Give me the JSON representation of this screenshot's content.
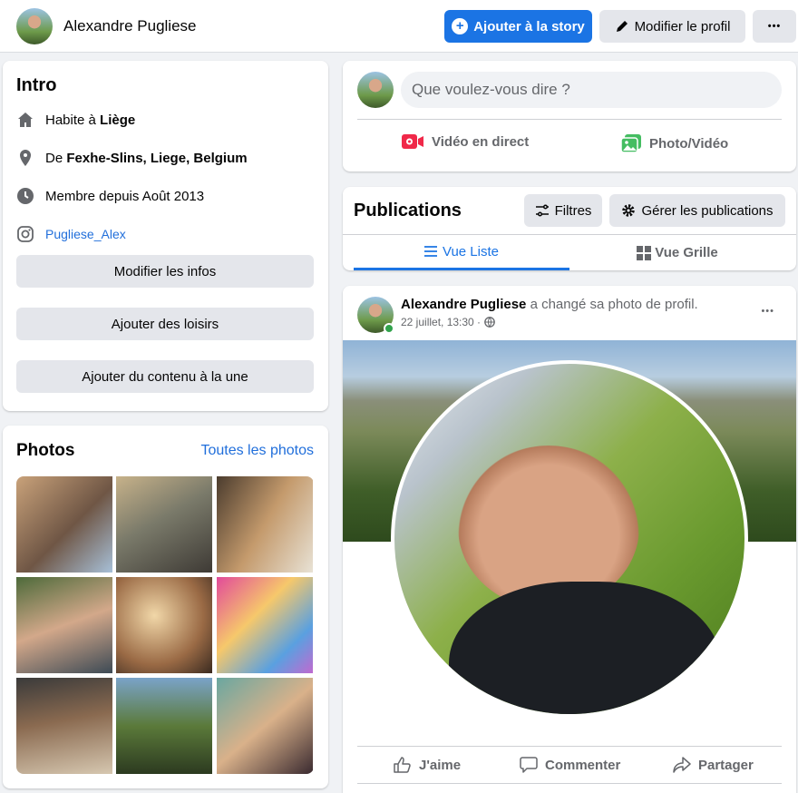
{
  "header": {
    "name": "Alexandre Pugliese",
    "add_story_label": "Ajouter à la story",
    "edit_profile_label": "Modifier le profil",
    "more_label": "•••"
  },
  "intro": {
    "title": "Intro",
    "lives_prefix": "Habite à",
    "lives_place": "Liège",
    "from_prefix": "De",
    "from_place": "Fexhe-Slins, Liege, Belgium",
    "member_since": "Membre depuis Août 2013",
    "instagram": "Pugliese_Alex",
    "edit_info_label": "Modifier les infos",
    "add_hobbies_label": "Ajouter des loisirs",
    "add_featured_label": "Ajouter du contenu à la une"
  },
  "photos": {
    "title": "Photos",
    "see_all_label": "Toutes les photos"
  },
  "composer": {
    "placeholder": "Que voulez-vous dire ?",
    "live_label": "Vidéo en direct",
    "photo_label": "Photo/Vidéo"
  },
  "publications": {
    "title": "Publications",
    "filters_label": "Filtres",
    "manage_label": "Gérer les publications",
    "list_view_label": "Vue Liste",
    "grid_view_label": "Vue Grille"
  },
  "post": {
    "author": "Alexandre Pugliese",
    "action": "a changé sa photo de profil.",
    "timestamp": "22 juillet, 13:30 ·",
    "more_label": "•••",
    "like_label": "J'aime",
    "comment_label": "Commenter",
    "share_label": "Partager"
  },
  "colors": {
    "accent": "#1b74e4",
    "live_red": "#f02849",
    "photo_green": "#45bd62",
    "online_green": "#31a24c"
  }
}
